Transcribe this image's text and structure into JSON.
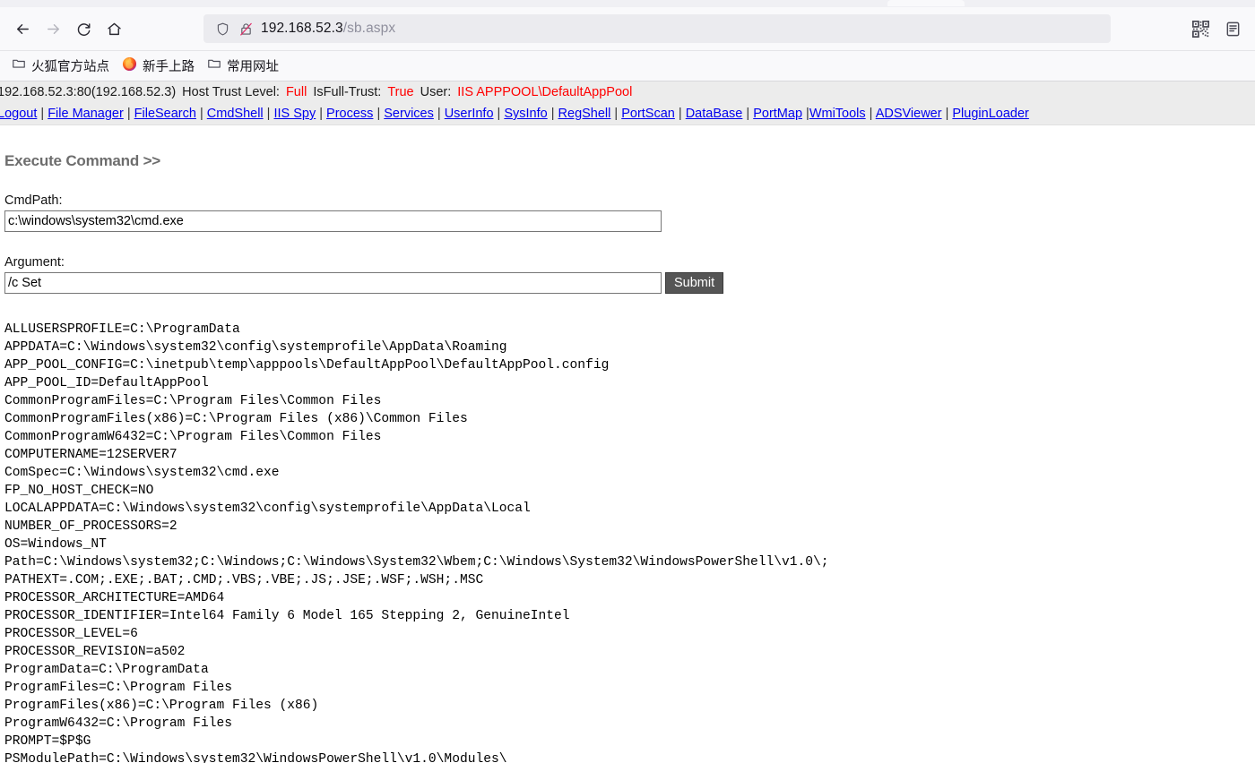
{
  "browser": {
    "back_label": "Back",
    "forward_label": "Forward",
    "reload_label": "Reload",
    "home_label": "Home",
    "url_host": "192.168.52.3",
    "url_path": "/sb.aspx",
    "shield_icon": "shield-icon",
    "lock_broken_icon": "lock-crossed-icon",
    "qr_icon": "qr-code-icon",
    "reader_icon": "reader-view-icon",
    "bookmarks": [
      {
        "label": "火狐官方站点",
        "icon": "folder-icon"
      },
      {
        "label": "新手上路",
        "icon": "firefox-icon"
      },
      {
        "label": "常用网址",
        "icon": "folder-icon"
      }
    ]
  },
  "infobar": {
    "server": "192.168.52.3:80(192.168.52.3)",
    "trust_label": "Host Trust Level:",
    "trust_value": "Full",
    "isfull_label": "IsFull-Trust:",
    "isfull_value": "True",
    "user_label": "User:",
    "user_value": "IIS APPPOOL\\DefaultAppPool",
    "accent_color": "#ff0000"
  },
  "navlinks": [
    "Logout",
    "File Manager",
    "FileSearch",
    "CmdShell",
    "IIS Spy",
    "Process",
    "Services",
    "UserInfo",
    "SysInfo",
    "RegShell",
    "PortScan",
    "DataBase",
    "PortMap",
    "WmiTools",
    "ADSViewer",
    "PluginLoader"
  ],
  "main": {
    "heading": "Execute Command >>",
    "cmdpath_label": "CmdPath:",
    "cmdpath_value": "c:\\windows\\system32\\cmd.exe",
    "argument_label": "Argument:",
    "argument_value": "/c Set",
    "submit_label": "Submit",
    "output": "ALLUSERSPROFILE=C:\\ProgramData\nAPPDATA=C:\\Windows\\system32\\config\\systemprofile\\AppData\\Roaming\nAPP_POOL_CONFIG=C:\\inetpub\\temp\\apppools\\DefaultAppPool\\DefaultAppPool.config\nAPP_POOL_ID=DefaultAppPool\nCommonProgramFiles=C:\\Program Files\\Common Files\nCommonProgramFiles(x86)=C:\\Program Files (x86)\\Common Files\nCommonProgramW6432=C:\\Program Files\\Common Files\nCOMPUTERNAME=12SERVER7\nComSpec=C:\\Windows\\system32\\cmd.exe\nFP_NO_HOST_CHECK=NO\nLOCALAPPDATA=C:\\Windows\\system32\\config\\systemprofile\\AppData\\Local\nNUMBER_OF_PROCESSORS=2\nOS=Windows_NT\nPath=C:\\Windows\\system32;C:\\Windows;C:\\Windows\\System32\\Wbem;C:\\Windows\\System32\\WindowsPowerShell\\v1.0\\;\nPATHEXT=.COM;.EXE;.BAT;.CMD;.VBS;.VBE;.JS;.JSE;.WSF;.WSH;.MSC\nPROCESSOR_ARCHITECTURE=AMD64\nPROCESSOR_IDENTIFIER=Intel64 Family 6 Model 165 Stepping 2, GenuineIntel\nPROCESSOR_LEVEL=6\nPROCESSOR_REVISION=a502\nProgramData=C:\\ProgramData\nProgramFiles=C:\\Program Files\nProgramFiles(x86)=C:\\Program Files (x86)\nProgramW6432=C:\\Program Files\nPROMPT=$P$G\nPSModulePath=C:\\Windows\\system32\\WindowsPowerShell\\v1.0\\Modules\\"
  }
}
